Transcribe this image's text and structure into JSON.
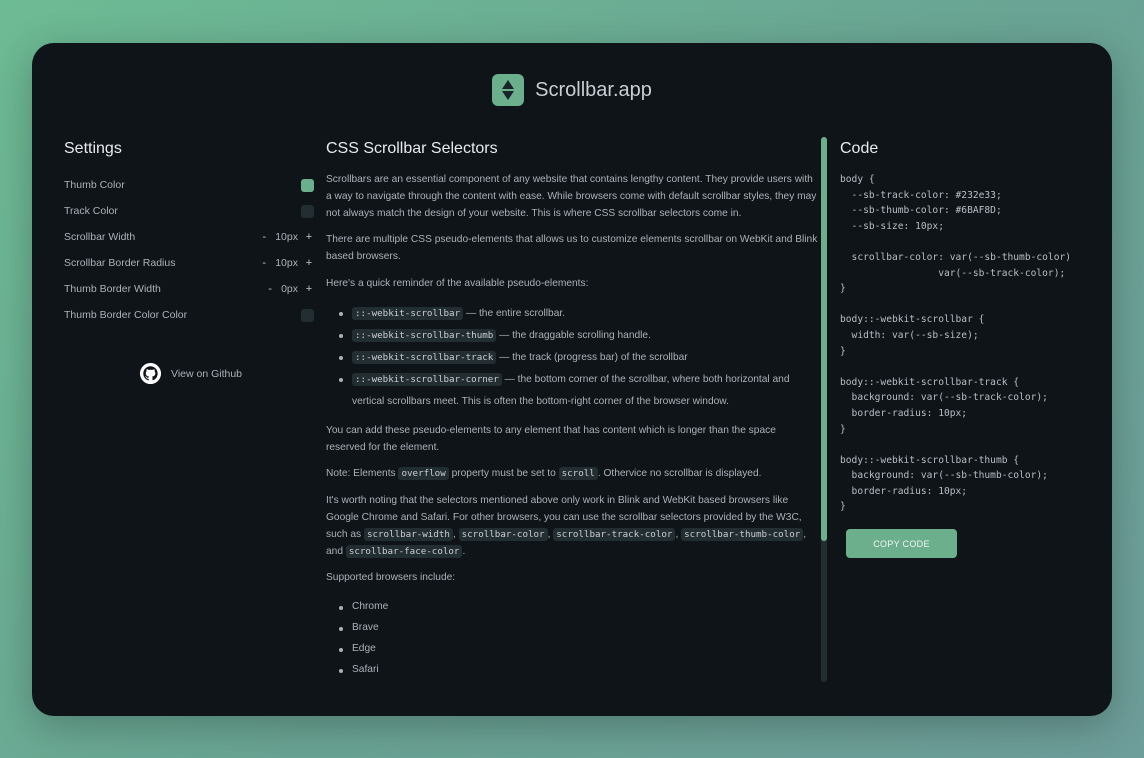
{
  "brand": {
    "name": "Scrollbar.app"
  },
  "settings": {
    "title": "Settings",
    "thumb_color_label": "Thumb Color",
    "track_color_label": "Track Color",
    "width_label": "Scrollbar Width",
    "width_value": "10px",
    "radius_label": "Scrollbar Border Radius",
    "radius_value": "10px",
    "thumb_border_width_label": "Thumb Border Width",
    "thumb_border_width_value": "0px",
    "thumb_border_color_label": "Thumb Border Color Color",
    "minus": "-",
    "plus": "+",
    "colors": {
      "thumb": "#6BAF8D",
      "track": "#232e33",
      "thumb_border": "#232e33"
    }
  },
  "github": {
    "label": "View on Github"
  },
  "article": {
    "title": "CSS Scrollbar Selectors",
    "p1": "Scrollbars are an essential component of any website that contains lengthy content. They provide users with a way to navigate through the content with ease. While browsers come with default scrollbar styles, they may not always match the design of your website. This is where CSS scrollbar selectors come in.",
    "p2": "There are multiple CSS pseudo-elements that allows us to customize elements scrollbar on WebKit and Blink based browsers.",
    "p3": "Here's a quick reminder of the available pseudo-elements:",
    "pseudo": [
      {
        "code": "::-webkit-scrollbar",
        "text": " — the entire scrollbar."
      },
      {
        "code": "::-webkit-scrollbar-thumb",
        "text": " — the draggable scrolling handle."
      },
      {
        "code": "::-webkit-scrollbar-track",
        "text": " — the track (progress bar) of the scrollbar"
      },
      {
        "code": "::-webkit-scrollbar-corner",
        "text": " — the bottom corner of the scrollbar, where both horizontal and vertical scrollbars meet. This is often the bottom-right corner of the browser window."
      }
    ],
    "p4": "You can add these pseudo-elements to any element that has content which is longer than the space reserved for the element.",
    "note": {
      "prefix": "Note: Elements ",
      "code1": "overflow",
      "mid": " property must be set to ",
      "code2": "scroll",
      "suffix": ". Othervice no scrollbar is displayed."
    },
    "p5": {
      "prefix": "It's worth noting that the selectors mentioned above only work in Blink and WebKit based browsers like Google Chrome and Safari. For other browsers, you can use the scrollbar selectors provided by the W3C, such as ",
      "c1": "scrollbar-width",
      "c2": "scrollbar-color",
      "c3": "scrollbar-track-color",
      "c4": "scrollbar-thumb-color",
      "c5": "scrollbar-face-color",
      "sep": ", ",
      "and": ", and ",
      "end": "."
    },
    "p6": "Supported browsers include:",
    "browsers": [
      "Chrome",
      "Brave",
      "Edge",
      "Safari"
    ]
  },
  "scroll_position_fraction": 0,
  "code": {
    "title": "Code",
    "snippet": "body {\n  --sb-track-color: #232e33;\n  --sb-thumb-color: #6BAF8D;\n  --sb-size: 10px;\n\n  scrollbar-color: var(--sb-thumb-color)\n                 var(--sb-track-color);\n}\n\nbody::-webkit-scrollbar {\n  width: var(--sb-size);\n}\n\nbody::-webkit-scrollbar-track {\n  background: var(--sb-track-color);\n  border-radius: 10px;\n}\n\nbody::-webkit-scrollbar-thumb {\n  background: var(--sb-thumb-color);\n  border-radius: 10px;\n}",
    "copy_label": "COPY CODE"
  }
}
